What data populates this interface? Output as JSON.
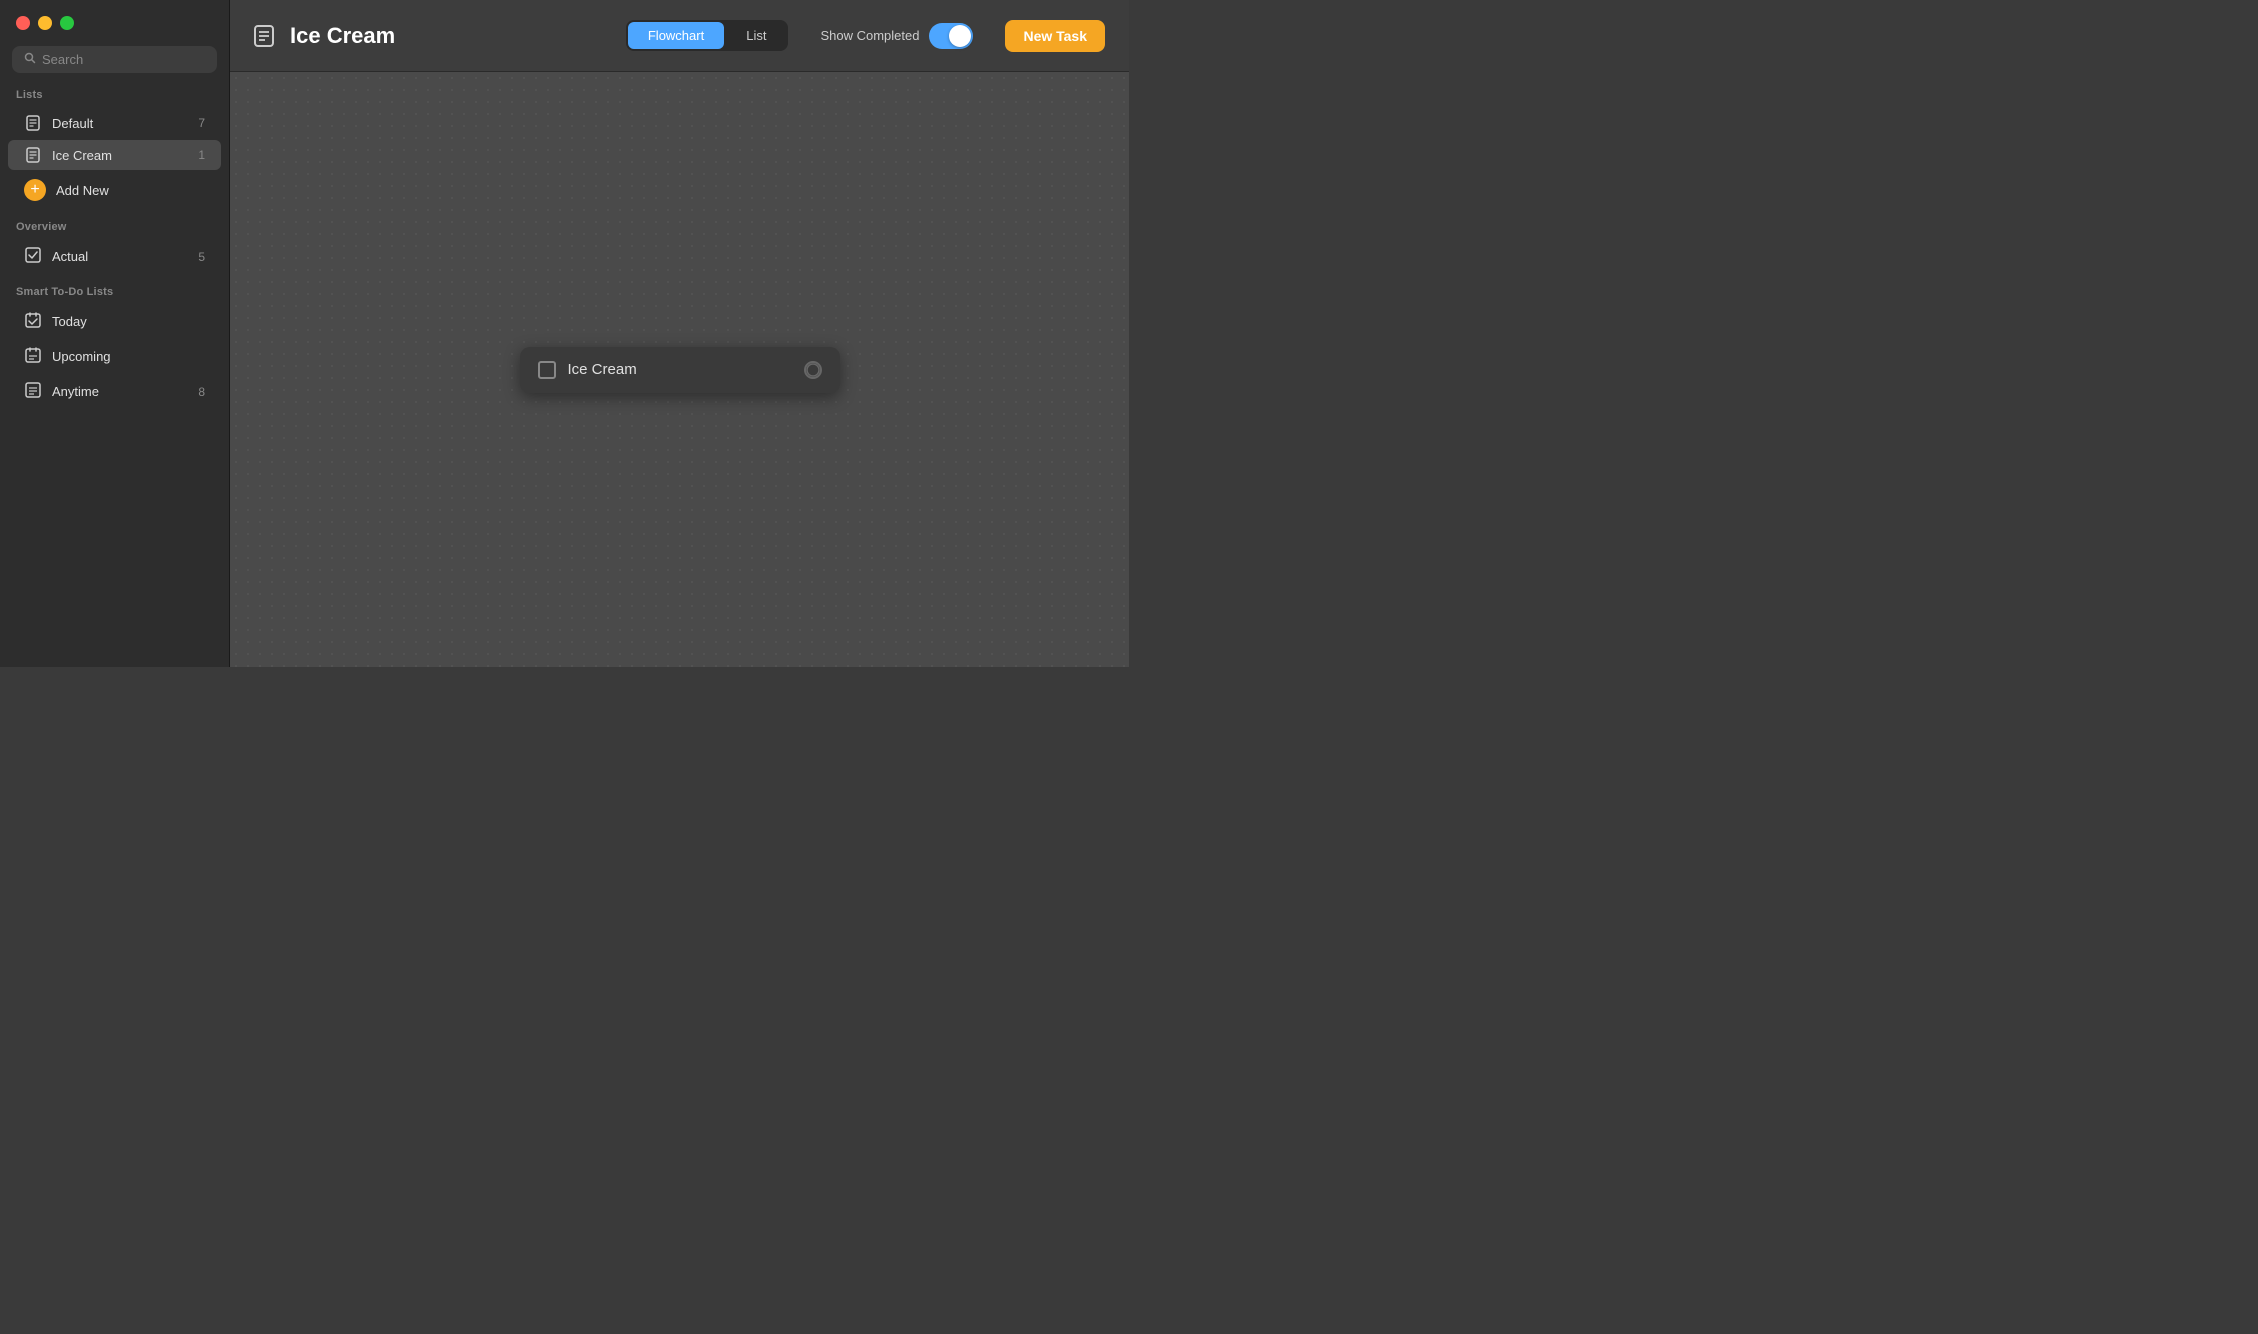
{
  "window": {
    "title": "Ice Cream"
  },
  "traffic_lights": {
    "red_label": "close",
    "yellow_label": "minimize",
    "green_label": "maximize"
  },
  "sidebar": {
    "search_placeholder": "Search",
    "lists_section_label": "Lists",
    "overview_section_label": "Overview",
    "smart_section_label": "Smart To-Do Lists",
    "lists": [
      {
        "id": "default",
        "label": "Default",
        "badge": "7"
      },
      {
        "id": "ice-cream",
        "label": "Ice Cream",
        "badge": "1",
        "active": true
      }
    ],
    "add_new_label": "Add New",
    "overview_items": [
      {
        "id": "actual",
        "label": "Actual",
        "badge": "5"
      }
    ],
    "smart_items": [
      {
        "id": "today",
        "label": "Today",
        "badge": ""
      },
      {
        "id": "upcoming",
        "label": "Upcoming",
        "badge": ""
      },
      {
        "id": "anytime",
        "label": "Anytime",
        "badge": "8"
      }
    ]
  },
  "header": {
    "title": "Ice Cream",
    "view_toggle": {
      "flowchart_label": "Flowchart",
      "list_label": "List",
      "active": "flowchart"
    },
    "show_completed_label": "Show Completed",
    "new_task_label": "New Task"
  },
  "flowchart": {
    "task": {
      "label": "Ice Cream"
    }
  },
  "colors": {
    "accent_blue": "#4da6ff",
    "accent_orange": "#f5a623",
    "traffic_red": "#ff5f57",
    "traffic_yellow": "#febc2e",
    "traffic_green": "#28c840"
  }
}
